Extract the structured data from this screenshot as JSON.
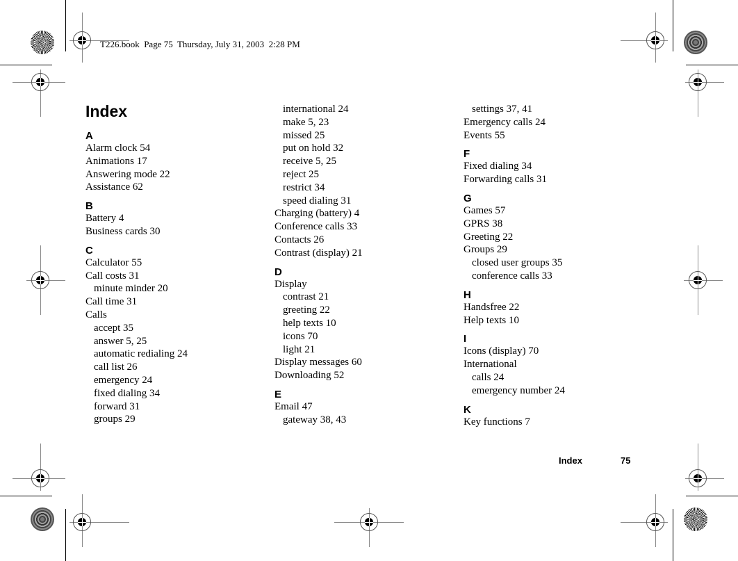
{
  "slug": "T226.book  Page 75  Thursday, July 31, 2003  2:28 PM",
  "title": "Index",
  "footer": {
    "label": "Index",
    "page": "75"
  },
  "columns": [
    [
      {
        "type": "letter",
        "text": "A"
      },
      {
        "type": "entry",
        "text": "Alarm clock 54"
      },
      {
        "type": "entry",
        "text": "Animations 17"
      },
      {
        "type": "entry",
        "text": "Answering mode 22"
      },
      {
        "type": "entry",
        "text": "Assistance 62"
      },
      {
        "type": "letter",
        "text": "B"
      },
      {
        "type": "entry",
        "text": "Battery 4"
      },
      {
        "type": "entry",
        "text": "Business cards 30"
      },
      {
        "type": "letter",
        "text": "C"
      },
      {
        "type": "entry",
        "text": "Calculator 55"
      },
      {
        "type": "entry",
        "text": "Call costs 31"
      },
      {
        "type": "sub",
        "text": "minute minder 20"
      },
      {
        "type": "entry",
        "text": "Call time 31"
      },
      {
        "type": "entry",
        "text": "Calls"
      },
      {
        "type": "sub",
        "text": "accept 35"
      },
      {
        "type": "sub",
        "text": "answer 5, 25"
      },
      {
        "type": "sub",
        "text": "automatic redialing 24"
      },
      {
        "type": "sub",
        "text": "call list 26"
      },
      {
        "type": "sub",
        "text": "emergency 24"
      },
      {
        "type": "sub",
        "text": "fixed dialing 34"
      },
      {
        "type": "sub",
        "text": "forward 31"
      },
      {
        "type": "sub",
        "text": "groups 29"
      }
    ],
    [
      {
        "type": "sub",
        "text": "international 24"
      },
      {
        "type": "sub",
        "text": "make 5, 23"
      },
      {
        "type": "sub",
        "text": "missed 25"
      },
      {
        "type": "sub",
        "text": "put on hold 32"
      },
      {
        "type": "sub",
        "text": "receive 5, 25"
      },
      {
        "type": "sub",
        "text": "reject 25"
      },
      {
        "type": "sub",
        "text": "restrict 34"
      },
      {
        "type": "sub",
        "text": "speed dialing 31"
      },
      {
        "type": "entry",
        "text": "Charging (battery) 4"
      },
      {
        "type": "entry",
        "text": "Conference calls 33"
      },
      {
        "type": "entry",
        "text": "Contacts 26"
      },
      {
        "type": "entry",
        "text": "Contrast (display) 21"
      },
      {
        "type": "letter",
        "text": "D"
      },
      {
        "type": "entry",
        "text": "Display"
      },
      {
        "type": "sub",
        "text": "contrast 21"
      },
      {
        "type": "sub",
        "text": "greeting 22"
      },
      {
        "type": "sub",
        "text": "help texts 10"
      },
      {
        "type": "sub",
        "text": "icons 70"
      },
      {
        "type": "sub",
        "text": "light 21"
      },
      {
        "type": "entry",
        "text": "Display messages 60"
      },
      {
        "type": "entry",
        "text": "Downloading 52"
      },
      {
        "type": "letter",
        "text": "E"
      },
      {
        "type": "entry",
        "text": "Email 47"
      },
      {
        "type": "sub",
        "text": "gateway 38, 43"
      }
    ],
    [
      {
        "type": "sub",
        "text": "settings 37, 41"
      },
      {
        "type": "entry",
        "text": "Emergency calls 24"
      },
      {
        "type": "entry",
        "text": "Events 55"
      },
      {
        "type": "letter",
        "text": "F"
      },
      {
        "type": "entry",
        "text": "Fixed dialing 34"
      },
      {
        "type": "entry",
        "text": "Forwarding calls 31"
      },
      {
        "type": "letter",
        "text": "G"
      },
      {
        "type": "entry",
        "text": "Games 57"
      },
      {
        "type": "entry",
        "text": "GPRS 38"
      },
      {
        "type": "entry",
        "text": "Greeting 22"
      },
      {
        "type": "entry",
        "text": "Groups 29"
      },
      {
        "type": "sub",
        "text": "closed user groups 35"
      },
      {
        "type": "sub",
        "text": "conference calls 33"
      },
      {
        "type": "letter",
        "text": "H"
      },
      {
        "type": "entry",
        "text": "Handsfree 22"
      },
      {
        "type": "entry",
        "text": "Help texts 10"
      },
      {
        "type": "letter",
        "text": "I"
      },
      {
        "type": "entry",
        "text": "Icons (display) 70"
      },
      {
        "type": "entry",
        "text": "International"
      },
      {
        "type": "sub",
        "text": "calls 24"
      },
      {
        "type": "sub",
        "text": "emergency number 24"
      },
      {
        "type": "letter",
        "text": "K"
      },
      {
        "type": "entry",
        "text": "Key functions 7"
      }
    ]
  ]
}
